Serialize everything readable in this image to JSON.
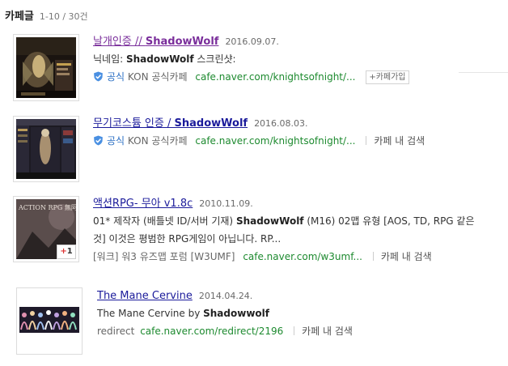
{
  "header": {
    "title": "카페글",
    "count": "1-10 / 30건"
  },
  "results": [
    {
      "title_pre": "날개인증 // ",
      "title_bold": "ShadowWolf",
      "date": "2016.09.07.",
      "desc_pre": "닉네임: ",
      "desc_bold": "ShadowWolf",
      "desc_post": " 스크린샷:",
      "official_label": "공식",
      "cafe_name": "KON 공식카페",
      "url": "cafe.naver.com/knightsofnight/...",
      "join_label": "+카페가입"
    },
    {
      "title_pre": "무기코스튬 인증 / ",
      "title_bold": "ShadowWolf",
      "date": "2016.08.03.",
      "official_label": "공식",
      "cafe_name": "KON 공식카페",
      "url": "cafe.naver.com/knightsofnight/...",
      "cafe_search_label": "카페 내 검색"
    },
    {
      "title_pre": "액션RPG- 무아 v1.8c",
      "date": "2010.11.09.",
      "desc1_pre": "01* 제작자 (배틀넷 ID/서버 기재) ",
      "desc1_bold": "ShadowWolf",
      "desc1_post": " (M16) 02맵 유형 [AOS, TD, RPG 같은",
      "desc2": "것] 이것은 평범한 RPG게임이 아닙니다. RP...",
      "cafe_name": "[워크] 워3 유즈맵 포럼 [W3UMF]",
      "url": "cafe.naver.com/w3umf...",
      "cafe_search_label": "카페 내 검색",
      "badge_plus": "+",
      "badge_count": "1",
      "thumb_text": "ACTION RPG 無阿"
    },
    {
      "title_pre": "The Mane Cervine",
      "date": "2014.04.24.",
      "desc_pre": "The Mane Cervine by ",
      "desc_bold": "Shadowwolf",
      "source_label": "redirect",
      "url": "cafe.naver.com/redirect/2196",
      "cafe_search_label": "카페 내 검색"
    }
  ]
}
